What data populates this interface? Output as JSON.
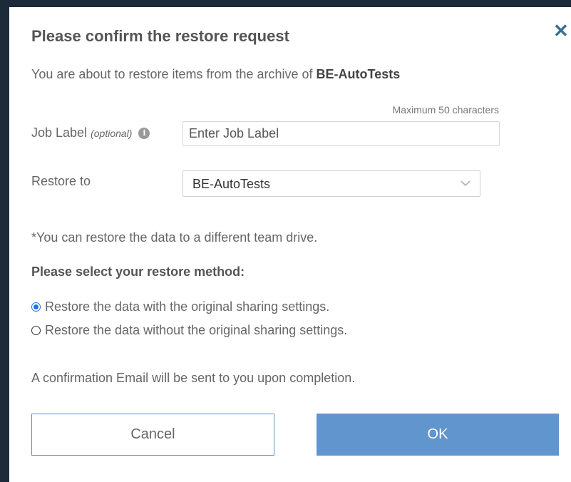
{
  "dialog": {
    "title": "Please confirm the restore request",
    "close_icon": "close-icon",
    "intro_text": "You are about to restore items from the archive of ",
    "intro_target": "BE-AutoTests",
    "max_chars_hint": "Maximum 50 characters",
    "job_label": {
      "label": "Job Label",
      "optional": "(optional)",
      "info_icon": "i",
      "placeholder": "Enter Job Label",
      "value": ""
    },
    "restore_to": {
      "label": "Restore to",
      "selected": "BE-AutoTests"
    },
    "note": "*You can restore the data to a different team drive.",
    "method_heading": "Please select your restore method:",
    "methods": [
      {
        "label": "Restore the data with the original sharing settings.",
        "checked": true
      },
      {
        "label": "Restore the data without the original sharing settings.",
        "checked": false
      }
    ],
    "confirmation_text": "A confirmation Email will be sent to you upon completion.",
    "buttons": {
      "cancel": "Cancel",
      "ok": "OK"
    }
  },
  "colors": {
    "accent": "#6195cd",
    "close_icon": "#3a6f93",
    "radio_checked": "#1a73e8"
  }
}
